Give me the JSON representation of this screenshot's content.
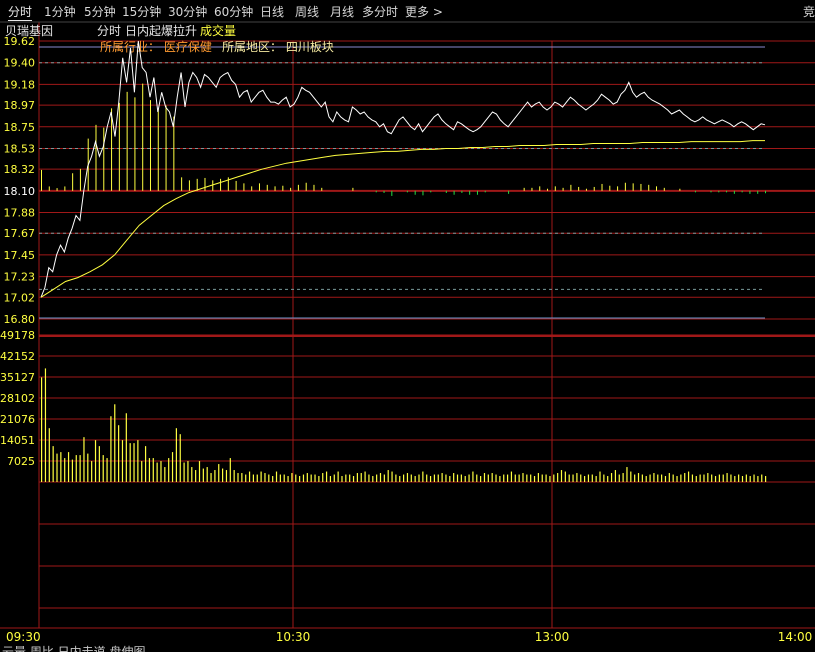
{
  "tabs": [
    {
      "label": "分时",
      "active": true
    },
    {
      "label": "1分钟"
    },
    {
      "label": "5分钟"
    },
    {
      "label": "15分钟"
    },
    {
      "label": "30分钟"
    },
    {
      "label": "60分钟"
    },
    {
      "label": "日线"
    },
    {
      "label": "周线"
    },
    {
      "label": "月线"
    },
    {
      "label": "多分时"
    },
    {
      "label": "更多 >"
    }
  ],
  "tab_right_char": "竞",
  "header": {
    "stock_name": "贝瑞基因",
    "mode": "分时",
    "pattern": "日内起爆拉升",
    "indicator": "成交量",
    "industry": "所属行业：  医疗保健",
    "region": "所属地区：  四川板块"
  },
  "bottom_bar": "云量  周比  日内走道  盘伸图",
  "colors": {
    "price_line": "#ffffff",
    "avg_line": "#ffff40",
    "up": "#ffff40",
    "down": "#22dd44",
    "grid": "#a01818",
    "axis_label": "#ffff40",
    "header_text": "#ff9a30"
  },
  "chart_data": [
    {
      "type": "line",
      "title": "",
      "y_ticks": [
        "19.62",
        "19.40",
        "19.18",
        "18.97",
        "18.75",
        "18.53",
        "18.32",
        "18.10",
        "17.88",
        "17.67",
        "17.45",
        "17.23",
        "17.02",
        "16.80"
      ],
      "prev_close": 18.1,
      "ylim": [
        16.8,
        19.62
      ],
      "x_ticks": [
        "09:30",
        "10:30",
        "13:00",
        "14:00"
      ],
      "series": [
        {
          "values": [
            17.02,
            17.12,
            17.32,
            17.28,
            17.45,
            17.55,
            17.48,
            17.62,
            17.72,
            17.85,
            17.8,
            18.1,
            18.35,
            18.45,
            18.6,
            18.45,
            18.55,
            18.75,
            18.9,
            18.65,
            19.0,
            19.45,
            19.2,
            19.55,
            19.1,
            19.62,
            19.35,
            19.3,
            19.05,
            19.25,
            18.9,
            19.1,
            18.95,
            18.9,
            18.75,
            19.05,
            19.3,
            18.95,
            19.2,
            19.3,
            19.25,
            19.15,
            19.28,
            19.25,
            19.2,
            19.15,
            19.25,
            19.28,
            19.3,
            19.22,
            19.18,
            19.05,
            19.1,
            19.12,
            19.0,
            19.05,
            19.1,
            19.12,
            19.05,
            19.0,
            19.0,
            18.98,
            19.02,
            19.05,
            18.95,
            18.98,
            19.05,
            19.15,
            19.12,
            19.1,
            19.05,
            19.0,
            18.95,
            19.0,
            18.85,
            18.8,
            18.9,
            18.85,
            18.82,
            18.8,
            18.95,
            18.92,
            18.88,
            18.9,
            18.85,
            18.82,
            18.8,
            18.75,
            18.78,
            18.7,
            18.68,
            18.75,
            18.82,
            18.85,
            18.8,
            18.75,
            18.72,
            18.78,
            18.7,
            18.75,
            18.8,
            18.85,
            18.88,
            18.82,
            18.78,
            18.75,
            18.72,
            18.8,
            18.78,
            18.75,
            18.72,
            18.7,
            18.72,
            18.75,
            18.8,
            18.85,
            18.9,
            18.88,
            18.82,
            18.78,
            18.75,
            18.8,
            18.85,
            18.9,
            18.95,
            19.0,
            18.95,
            18.98,
            19.0,
            18.95,
            18.92,
            18.95,
            19.0,
            18.98,
            18.95,
            19.0,
            19.05,
            19.02,
            18.98,
            18.95,
            18.92,
            18.95,
            18.98,
            19.02,
            19.08,
            19.05,
            19.02,
            18.98,
            19.0,
            19.08,
            19.12,
            19.2,
            19.1,
            19.05,
            19.08,
            19.1,
            19.05,
            19.02,
            19.0,
            18.98,
            18.95,
            18.92,
            18.88,
            18.9,
            18.92,
            18.88,
            18.85,
            18.82,
            18.8,
            18.82,
            18.85,
            18.82,
            18.8,
            18.78,
            18.8,
            18.82,
            18.8,
            18.78,
            18.75,
            18.78,
            18.8,
            18.78,
            18.75,
            18.72,
            18.75,
            18.78,
            18.77
          ]
        },
        {
          "values": [
            17.02,
            17.1,
            17.18,
            17.22,
            17.28,
            17.35,
            17.45,
            17.6,
            17.75,
            17.85,
            17.95,
            18.02,
            18.08,
            18.12,
            18.16,
            18.2,
            18.24,
            18.28,
            18.32,
            18.35,
            18.38,
            18.4,
            18.42,
            18.44,
            18.46,
            18.47,
            18.48,
            18.49,
            18.5,
            18.5,
            18.51,
            18.52,
            18.52,
            18.53,
            18.53,
            18.54,
            18.54,
            18.55,
            18.55,
            18.56,
            18.56,
            18.56,
            18.57,
            18.57,
            18.57,
            18.58,
            18.58,
            18.58,
            18.58,
            18.59,
            18.59,
            18.59,
            18.59,
            18.6,
            18.6,
            18.6,
            18.6,
            18.6,
            18.61,
            18.61
          ]
        }
      ]
    },
    {
      "type": "bar",
      "title": "成交量",
      "y_ticks": [
        "49178",
        "42152",
        "35127",
        "28102",
        "21076",
        "14051",
        "7025"
      ],
      "ylim": [
        0,
        49178
      ],
      "values": [
        35000,
        38000,
        18000,
        12000,
        9500,
        10000,
        8000,
        10000,
        7500,
        9000,
        9000,
        15000,
        9500,
        7000,
        14000,
        12000,
        9000,
        8000,
        22000,
        26000,
        19000,
        14000,
        23000,
        13000,
        13000,
        14000,
        7000,
        12000,
        8000,
        8000,
        6500,
        7000,
        5000,
        8000,
        10000,
        18000,
        16000,
        6500,
        7000,
        5000,
        4000,
        7000,
        4500,
        5000,
        3000,
        4000,
        6000,
        4500,
        4000,
        8000,
        4000,
        3000,
        3000,
        2500,
        3500,
        2500,
        2500,
        3500,
        3000,
        2500,
        2000,
        3500,
        2500,
        2500,
        2000,
        3000,
        2500,
        2000,
        2500,
        3000,
        2500,
        2500,
        2000,
        3000,
        3500,
        2000,
        2500,
        3500,
        2000,
        2500,
        2500,
        2000,
        3000,
        3000,
        3500,
        2500,
        2000,
        2500,
        3000,
        2500,
        4000,
        3500,
        2500,
        2000,
        2500,
        3000,
        2500,
        2000,
        2500,
        3500,
        2500,
        2000,
        2500,
        2500,
        3000,
        2500,
        2000,
        3000,
        2500,
        2500,
        2000,
        2500,
        3500,
        2500,
        2000,
        3000,
        2500,
        3000,
        2500,
        2000,
        2500,
        2500,
        3500,
        2500,
        2500,
        3000,
        2500,
        2500,
        2000,
        3000,
        2500,
        2500,
        2000,
        2500,
        3000,
        4000,
        3500,
        2500,
        2500,
        3000,
        2500,
        2000,
        2500,
        2500,
        2000,
        3500,
        2500,
        2000,
        3000,
        4000,
        2500,
        3000,
        5000,
        3500,
        2500,
        3000,
        2500,
        2000,
        2500,
        3000,
        2500,
        2500,
        2000,
        3000,
        2500,
        2000,
        2500,
        3000,
        3500,
        2500,
        2000,
        2500,
        2500,
        3000,
        2500,
        2000,
        2500,
        2500,
        3000,
        2500,
        2000,
        2500,
        2000,
        2500,
        2000,
        2500,
        2000,
        2500,
        2000
      ]
    }
  ]
}
